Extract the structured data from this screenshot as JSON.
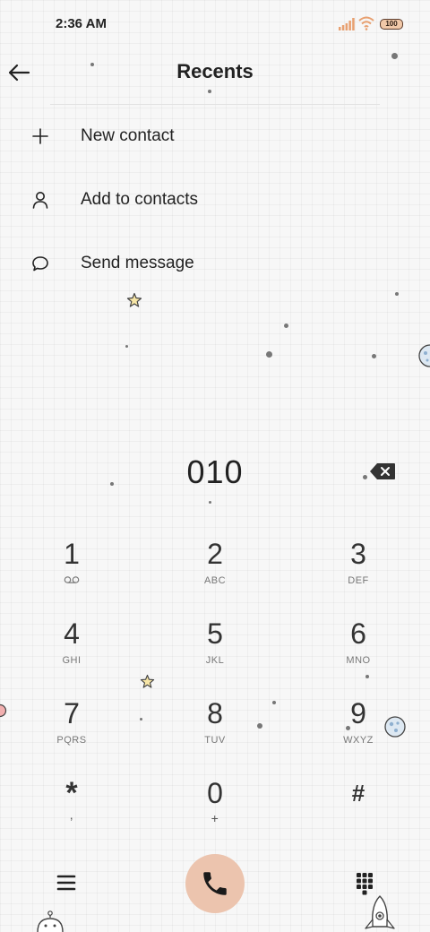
{
  "status": {
    "time": "2:36 AM",
    "battery": "100"
  },
  "header": {
    "title": "Recents"
  },
  "menu": {
    "items": [
      {
        "label": "New contact",
        "icon": "plus-icon"
      },
      {
        "label": "Add to contacts",
        "icon": "person-icon"
      },
      {
        "label": "Send message",
        "icon": "message-bubble-icon"
      }
    ]
  },
  "dialer": {
    "number": "010",
    "keys": [
      {
        "digit": "1",
        "sub": "voicemail-icon"
      },
      {
        "digit": "2",
        "sub": "ABC"
      },
      {
        "digit": "3",
        "sub": "DEF"
      },
      {
        "digit": "4",
        "sub": "GHI"
      },
      {
        "digit": "5",
        "sub": "JKL"
      },
      {
        "digit": "6",
        "sub": "MNO"
      },
      {
        "digit": "7",
        "sub": "PQRS"
      },
      {
        "digit": "8",
        "sub": "TUV"
      },
      {
        "digit": "9",
        "sub": "WXYZ"
      },
      {
        "digit": "*",
        "sub": ","
      },
      {
        "digit": "0",
        "sub": "+"
      },
      {
        "digit": "#",
        "sub": ""
      }
    ]
  },
  "colors": {
    "call_button": "#ecc4ae",
    "accent_status": "#e89a6a"
  }
}
